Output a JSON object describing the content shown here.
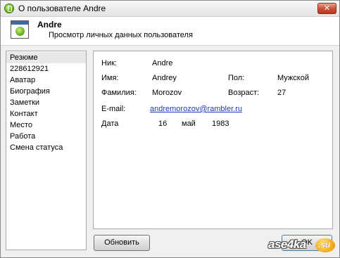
{
  "window": {
    "title": "О пользователе Andre",
    "close_label": "✕"
  },
  "header": {
    "name": "Andre",
    "subtitle": "Просмотр личных данных пользователя"
  },
  "sidebar": {
    "items": [
      {
        "label": "Резюме",
        "selected": true
      },
      {
        "label": "228612921"
      },
      {
        "label": "Аватар"
      },
      {
        "label": "Биография"
      },
      {
        "label": "Заметки"
      },
      {
        "label": "Контакт"
      },
      {
        "label": "Место"
      },
      {
        "label": "Работа"
      },
      {
        "label": "Смена статуса"
      }
    ]
  },
  "profile": {
    "nick_label": "Ник:",
    "nick": "Andre",
    "name_label": "Имя:",
    "name": "Andrey",
    "gender_label": "Пол:",
    "gender": "Мужской",
    "surname_label": "Фамилия:",
    "surname": "Morozov",
    "age_label": "Возраст:",
    "age": "27",
    "email_label": "E-mail:",
    "email": "andremorozov@rambler.ru",
    "birth_label": "Дата",
    "birth_day": "16",
    "birth_month": "май",
    "birth_year": "1983"
  },
  "buttons": {
    "refresh": "Обновить",
    "ok": "OK"
  },
  "watermark": {
    "text": "ase4ka",
    "badge": ".su"
  }
}
